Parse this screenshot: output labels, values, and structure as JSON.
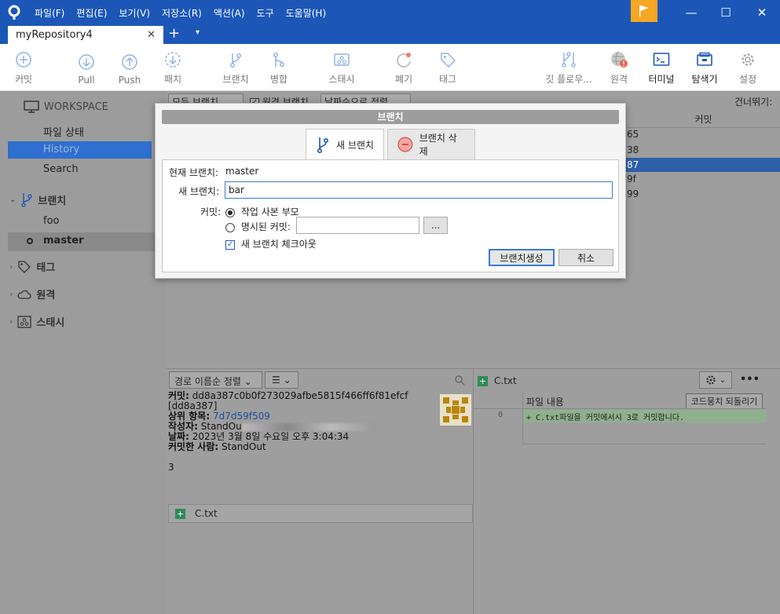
{
  "menu": [
    "파일(F)",
    "편집(E)",
    "보기(V)",
    "저장소(R)",
    "액션(A)",
    "도구",
    "도움말(H)"
  ],
  "window_controls": {
    "minimize": "—",
    "maximize": "☐",
    "close": "✕"
  },
  "tab": {
    "label": "myRepository4",
    "close": "✕",
    "add": "+",
    "dropdown": "▾"
  },
  "toolbar": {
    "commit": "커밋",
    "pull": "Pull",
    "push": "Push",
    "fetch": "패치",
    "branch": "브랜치",
    "merge": "병합",
    "stash": "스태시",
    "discard": "폐기",
    "tag": "태그",
    "gitflow": "깃 플로우...",
    "remote": "원격",
    "terminal": "터미널",
    "explorer": "탐색기",
    "settings": "설정"
  },
  "sidebar": {
    "workspace": "WORKSPACE",
    "file_status": "파일 상태",
    "history": "History",
    "search": "Search",
    "branches": "브랜치",
    "branch_items": [
      "foo",
      "master"
    ],
    "tags": "태그",
    "remotes": "원격",
    "stashes": "스태시"
  },
  "history_bar": {
    "all_branches": "모든 브랜치",
    "remote_branches": "원격 브랜치",
    "sort": "날짜순으로 정렬",
    "skip": "건너뛰기:",
    "commit_header": "커밋",
    "commit_hash_fragments": [
      "65",
      "38",
      "87",
      "9f",
      "99"
    ]
  },
  "dialog": {
    "title": "브랜치",
    "tab_new": "새 브랜치",
    "tab_delete": "브랜치 삭제",
    "current_branch_label": "현재 브랜치:",
    "current_branch_value": "master",
    "new_branch_label": "새 브랜치:",
    "new_branch_value": "bar",
    "commit_label": "커밋:",
    "radio_parent": "작업 사본 부모",
    "radio_specified": "명시된 커밋:",
    "browse": "...",
    "checkout_label": "새 브랜치 체크아웃",
    "create_button": "브랜치생성",
    "cancel_button": "취소"
  },
  "file_panel": {
    "sort": "경로 이름순 정렬",
    "list_icon": "☰",
    "file": "C.txt"
  },
  "commit_info": {
    "commit_label": "커밋:",
    "commit_hash": "dd8a387c0b0f273029afbe5815f466ff6f81efcf",
    "short_hash": "[dd8a387]",
    "parent_label": "상위 항목:",
    "parent_hash": "7d7d59f509",
    "author_label": "작성자:",
    "author": "StandOu",
    "date_label": "날짜:",
    "date": "2023년 3월 8일 수요일 오후 3:04:34",
    "committer_label": "커밋한 사람:",
    "committer": "StandOut",
    "message": "3"
  },
  "diff_panel": {
    "file": "C.txt",
    "header": "파일 내용",
    "revert": "코드뭉치 되돌리기",
    "line_no": "0",
    "line": "+ C.txt파일을 커밋에서시 3로 커밋합니다.",
    "more": "•••"
  },
  "colors": {
    "accent": "#1c57b7",
    "flag": "#f5a623",
    "selection": "#2f6fcf"
  }
}
